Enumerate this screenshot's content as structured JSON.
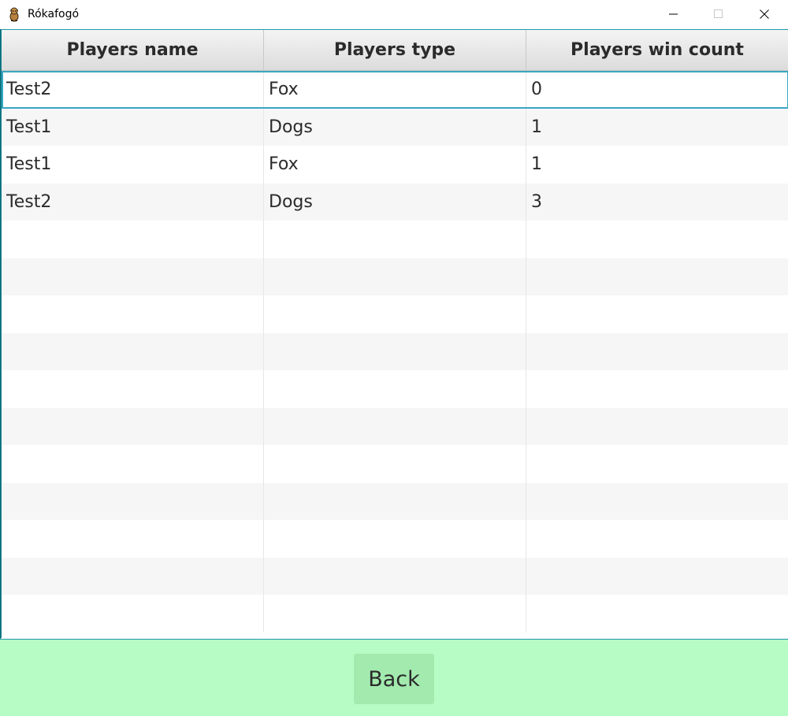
{
  "window": {
    "title": "Rókafogó",
    "app_icon": "dog-icon",
    "controls": [
      "minimize-icon",
      "maximize-icon",
      "close-icon"
    ]
  },
  "table": {
    "columns": [
      "Players name",
      "Players type",
      "Players win count"
    ],
    "rows": [
      [
        "Test2",
        "Fox",
        "0"
      ],
      [
        "Test1",
        "Dogs",
        "1"
      ],
      [
        "Test1",
        "Fox",
        "1"
      ],
      [
        "Test2",
        "Dogs",
        "3"
      ]
    ],
    "empty_rows": 11,
    "selected_row": 0
  },
  "footer": {
    "back_label": "Back",
    "background": "#b6fcc4",
    "button_color": "#a2eaae"
  },
  "colors": {
    "accent": "#39a6c3",
    "row_alt": "#f6f6f6",
    "header_top": "#f4f4f4",
    "header_bottom": "#dcdcdc"
  }
}
